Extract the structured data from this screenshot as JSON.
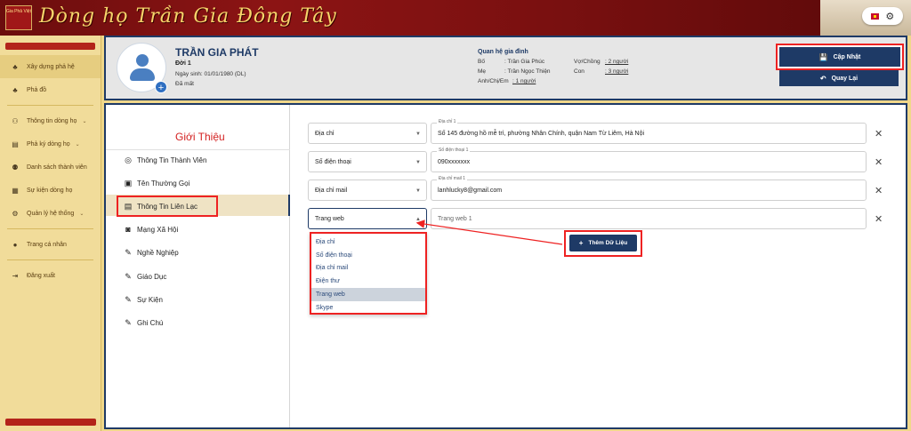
{
  "banner": {
    "logo_text": "Gia Phả Việt",
    "title": "Dòng họ Trần Gia Đông Tây"
  },
  "sidebar": {
    "items": [
      {
        "label": "Xây dựng phả hệ",
        "icon": "tree-icon"
      },
      {
        "label": "Phả đồ",
        "icon": "tree-icon"
      },
      {
        "label": "Thông tin dòng họ",
        "icon": "people-icon"
      },
      {
        "label": "Phả ký dòng họ",
        "icon": "book-icon"
      },
      {
        "label": "Danh sách thành viên",
        "icon": "users-icon"
      },
      {
        "label": "Sự kiện dòng họ",
        "icon": "calendar-icon"
      },
      {
        "label": "Quản lý hệ thống",
        "icon": "gear-icon"
      },
      {
        "label": "Trang cá nhân",
        "icon": "user-icon"
      },
      {
        "label": "Đăng xuất",
        "icon": "logout-icon"
      }
    ]
  },
  "person": {
    "name": "TRẦN GIA PHÁT",
    "generation": "Đời 1",
    "dob": "Ngày sinh:  01/01/1980 (DL)",
    "status": "Đã mất"
  },
  "relations": {
    "title": "Quan hệ gia đình",
    "father_label": "Bố",
    "father_value": ": Trần Gia Phúc",
    "mother_label": "Mẹ",
    "mother_value": ": Trần Ngọc Thiện",
    "siblings_label": "Anh/Chị/Em",
    "siblings_value": ": 1 người",
    "spouse_label": "Vợ/Chồng",
    "spouse_value": ": 2 người",
    "children_label": "Con",
    "children_value": ": 3 người"
  },
  "actions": {
    "update_label": "Cập Nhật",
    "back_label": "Quay Lại",
    "add_data_label": "Thêm Dữ Liệu"
  },
  "intro": {
    "title": "Giới Thiệu",
    "menu": [
      "Thông Tin Thành Viên",
      "Tên Thường Gọi",
      "Thông Tin Liên Lạc",
      "Mạng Xã Hội",
      "Nghề Nghiệp",
      "Giáo Dục",
      "Sự Kiện",
      "Ghi Chú"
    ]
  },
  "contacts": [
    {
      "type": "Địa chỉ",
      "label": "Địa chỉ 1",
      "value": "Số 145 đường hồ mễ trì, phường Nhân Chính, quận Nam Từ Liêm, Hà Nội"
    },
    {
      "type": "Số điện thoại",
      "label": "Số điện thoại 1",
      "value": "090xxxxxxx"
    },
    {
      "type": "Địa chỉ mail",
      "label": "Địa chỉ mail 1",
      "value": "lanhlucky8@gmail.com"
    },
    {
      "type": "Trang web",
      "label": "",
      "value": "Trang web 1"
    }
  ],
  "dropdown": {
    "options": [
      "Địa chỉ",
      "Số điện thoại",
      "Địa chỉ mail",
      "Điện thư",
      "Trang web",
      "Skype"
    ],
    "selected": "Trang web"
  },
  "colors": {
    "primary": "#1e3a66",
    "highlight": "#e22222",
    "accent_red": "#d32020"
  }
}
